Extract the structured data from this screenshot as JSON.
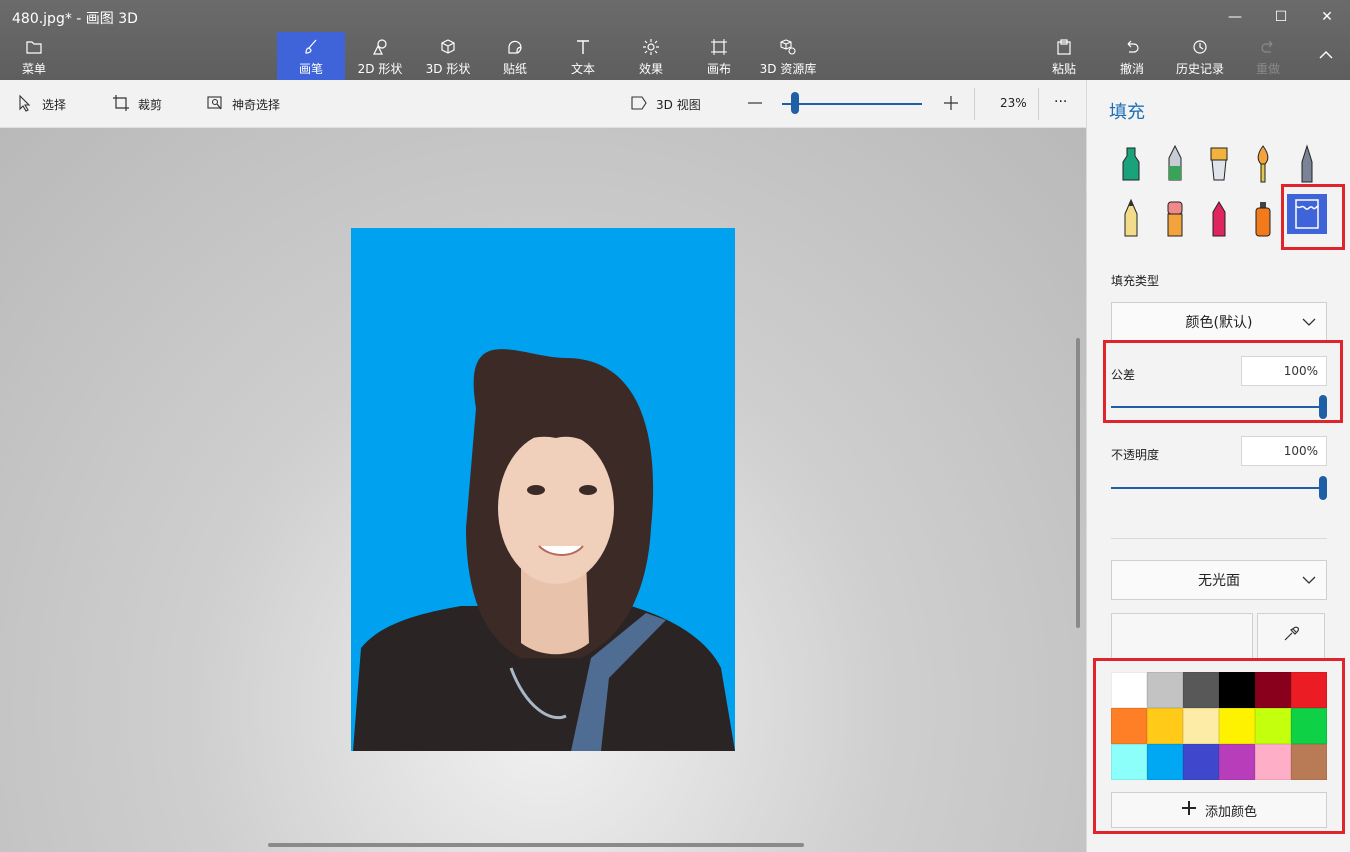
{
  "window": {
    "title": "480.jpg* - 画图 3D",
    "minimize": "—",
    "maximize": "☐",
    "close": "✕"
  },
  "ribbon": {
    "menu": "菜单",
    "tabs": [
      {
        "label": "画笔",
        "icon": "brush-icon",
        "active": true
      },
      {
        "label": "2D 形状",
        "icon": "2d-shapes-icon"
      },
      {
        "label": "3D 形状",
        "icon": "3d-shapes-icon"
      },
      {
        "label": "贴纸",
        "icon": "sticker-icon"
      },
      {
        "label": "文本",
        "icon": "text-icon"
      },
      {
        "label": "效果",
        "icon": "effects-icon"
      },
      {
        "label": "画布",
        "icon": "canvas-icon"
      },
      {
        "label": "3D 资源库",
        "icon": "3d-library-icon"
      }
    ],
    "paste": "粘贴",
    "undo": "撤消",
    "history": "历史记录",
    "redo": "重做"
  },
  "toolbar": {
    "select": "选择",
    "crop": "裁剪",
    "magic_select": "神奇选择",
    "view_3d": "3D 视图",
    "zoom_value": "23%",
    "zoom_fraction": 0.1,
    "more": "···"
  },
  "panel": {
    "title": "填充",
    "brushes_row1": [
      "marker-icon",
      "calligraphy-pen-icon",
      "oil-brush-icon",
      "watercolor-icon",
      "pixel-pen-icon"
    ],
    "brushes_row2": [
      "pencil-icon",
      "eraser-icon",
      "crayon-icon",
      "spray-can-icon",
      "fill-bucket-icon"
    ],
    "selected_brush": "fill-bucket-icon",
    "fill_type_label": "填充类型",
    "fill_type_value": "颜色(默认)",
    "tolerance_label": "公差",
    "tolerance_value": "100%",
    "tolerance_fraction": 1.0,
    "opacity_label": "不透明度",
    "opacity_value": "100%",
    "opacity_fraction": 1.0,
    "finish_value": "无光面",
    "add_color": "添加颜色",
    "palette": [
      "#ffffff",
      "#c3c3c3",
      "#585858",
      "#000000",
      "#88001b",
      "#ec1c24",
      "#ff7f27",
      "#ffca18",
      "#fdeca6",
      "#fff200",
      "#c4ff0e",
      "#0ed145",
      "#8cfffb",
      "#00a8f3",
      "#3f48cc",
      "#b83dba",
      "#ffaec8",
      "#b97a56"
    ],
    "accent": "#e0242c"
  }
}
